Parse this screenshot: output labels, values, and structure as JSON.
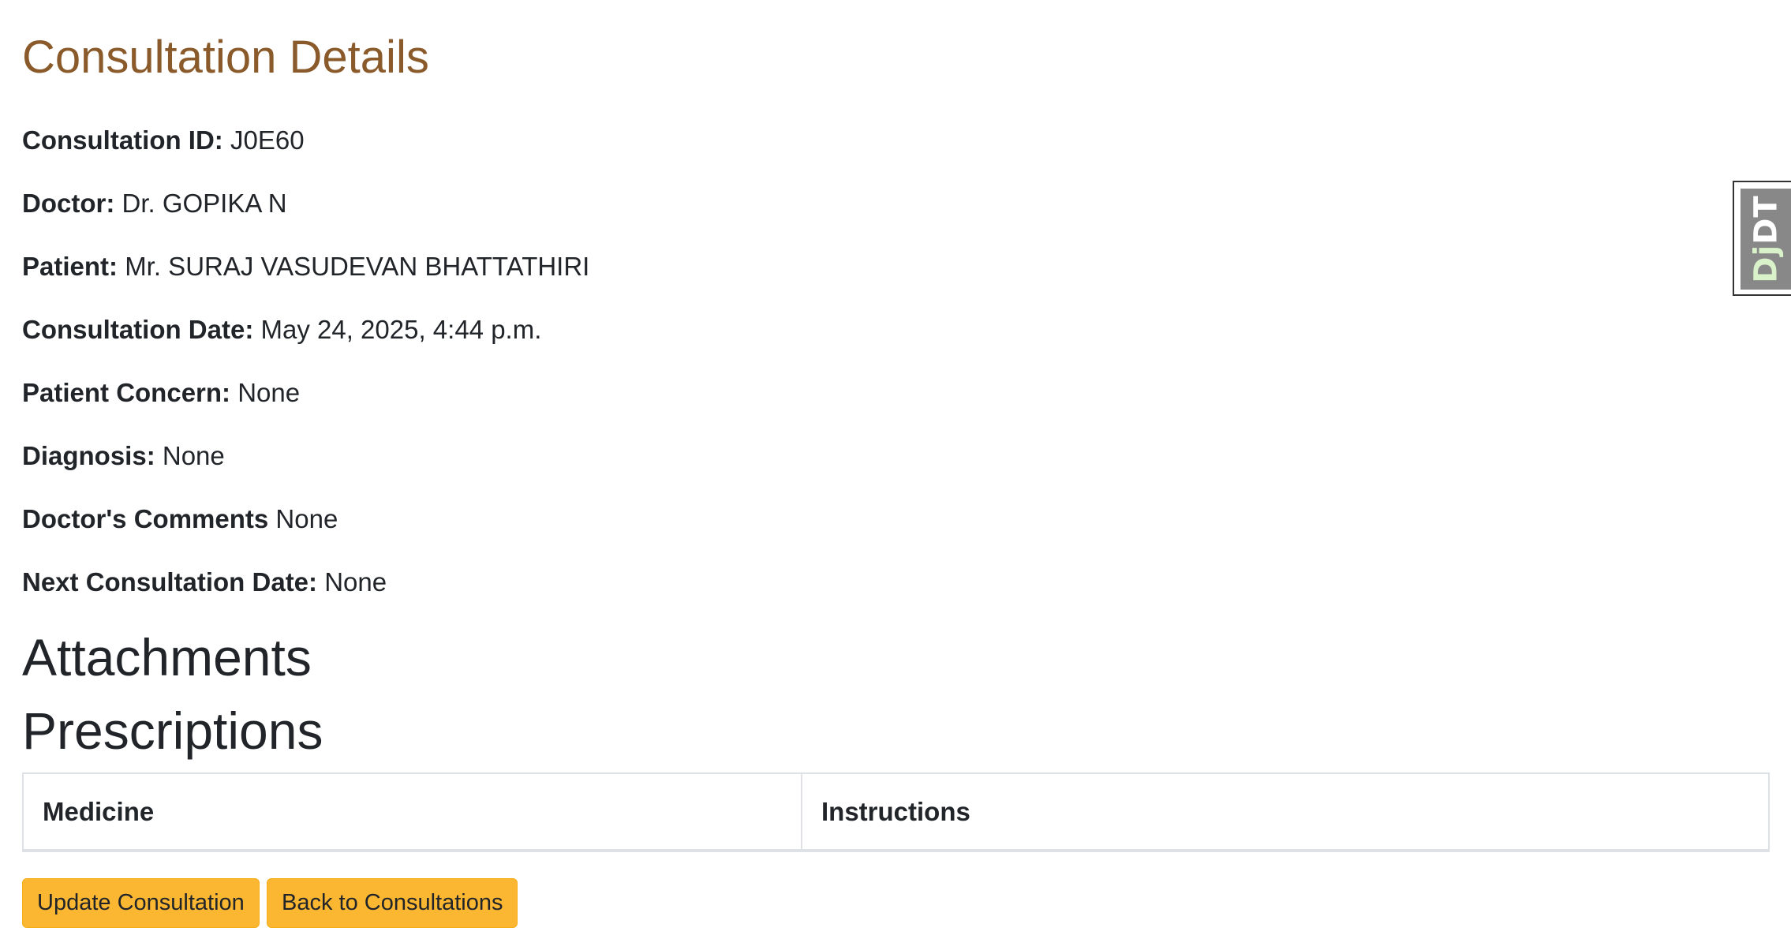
{
  "page": {
    "title": "Consultation Details"
  },
  "details": [
    {
      "label": "Consultation ID:",
      "value": "J0E60"
    },
    {
      "label": "Doctor:",
      "value": "Dr. GOPIKA N"
    },
    {
      "label": "Patient:",
      "value": "Mr. SURAJ VASUDEVAN BHATTATHIRI"
    },
    {
      "label": "Consultation Date:",
      "value": "May 24, 2025, 4:44 p.m."
    },
    {
      "label": "Patient Concern:",
      "value": "None"
    },
    {
      "label": "Diagnosis:",
      "value": "None"
    },
    {
      "label": "Doctor's Comments",
      "value": "None"
    },
    {
      "label": "Next Consultation Date:",
      "value": "None"
    }
  ],
  "sections": {
    "attachments": "Attachments",
    "prescriptions": "Prescriptions"
  },
  "prescriptions_table": {
    "columns": [
      "Medicine",
      "Instructions"
    ]
  },
  "actions": {
    "update_label": "Update Consultation",
    "back_label": "Back to Consultations"
  },
  "debug_toolbar": {
    "label_dj": "Dj",
    "label_dt": "DT"
  },
  "colors": {
    "title": "#8a5a2b",
    "button_bg": "#fbb731",
    "text": "#212529"
  }
}
